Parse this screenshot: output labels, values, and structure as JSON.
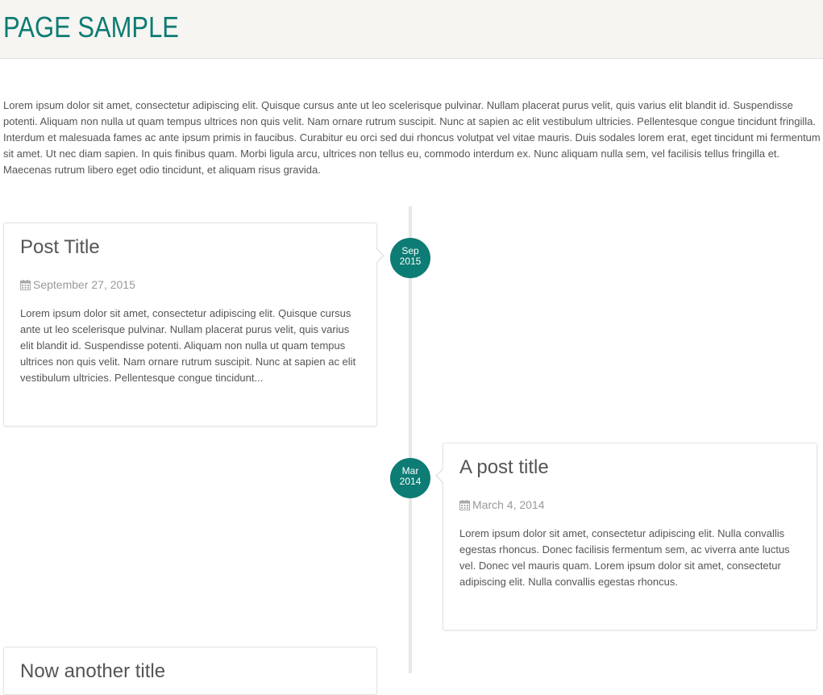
{
  "header": {
    "title": "PAGE SAMPLE"
  },
  "intro": "Lorem ipsum dolor sit amet, consectetur adipiscing elit. Quisque cursus ante ut leo scelerisque pulvinar. Nullam placerat purus velit, quis varius elit blandit id. Suspendisse potenti. Aliquam non nulla ut quam tempus ultrices non quis velit. Nam ornare rutrum suscipit. Nunc at sapien ac elit vestibulum ultricies. Pellentesque congue tincidunt fringilla. Interdum et malesuada fames ac ante ipsum primis in faucibus. Curabitur eu orci sed dui rhoncus volutpat vel vitae mauris. Duis sodales lorem erat, eget tincidunt mi fermentum sit amet. Ut nec diam sapien. In quis finibus quam. Morbi ligula arcu, ultrices non tellus eu, commodo interdum ex. Nunc aliquam nulla sem, vel facilisis tellus fringilla et. Maecenas rutrum libero eget odio tincidunt, et aliquam risus gravida.",
  "colors": {
    "accent": "#0c7c74",
    "header_bg": "#f6f5f1",
    "timeline_line": "#e7e7e7"
  },
  "posts": [
    {
      "title": "Post Title",
      "date": "September 27, 2015",
      "date_icon": "calendar-icon",
      "badge_month": "Sep",
      "badge_year": "2015",
      "excerpt": "Lorem ipsum dolor sit amet, consectetur adipiscing elit. Quisque cursus ante ut leo scelerisque pulvinar. Nullam placerat purus velit, quis varius elit blandit id. Suspendisse potenti. Aliquam non nulla ut quam tempus ultrices non quis velit. Nam ornare rutrum suscipit. Nunc at sapien ac elit vestibulum ultricies. Pellentesque congue tincidunt..."
    },
    {
      "title": "A post title",
      "date": "March 4, 2014",
      "date_icon": "calendar-icon",
      "badge_month": "Mar",
      "badge_year": "2014",
      "excerpt": "Lorem ipsum dolor sit amet, consectetur adipiscing elit. Nulla convallis egestas rhoncus. Donec facilisis fermentum sem, ac viverra ante luctus vel. Donec vel mauris quam. Lorem ipsum dolor sit amet, consectetur adipiscing elit. Nulla convallis egestas rhoncus."
    },
    {
      "title": "Now another title"
    }
  ]
}
